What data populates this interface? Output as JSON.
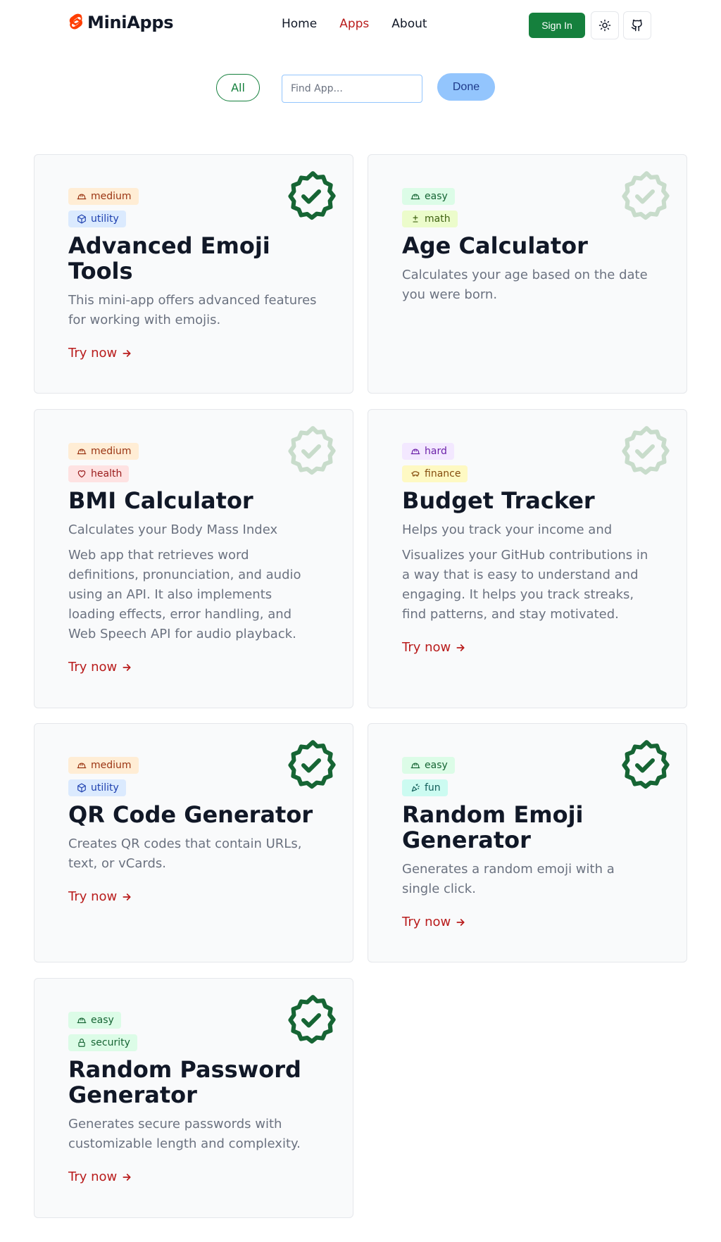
{
  "header": {
    "logo_text": "MiniApps",
    "nav": [
      {
        "label": "Home",
        "active": false
      },
      {
        "label": "Apps",
        "active": true
      },
      {
        "label": "About",
        "active": false
      }
    ],
    "sign_in_label": "Sign In",
    "theme_icon": "sun-icon",
    "github_icon": "github-icon"
  },
  "filters": {
    "all_label": "All",
    "search_placeholder": "Find App...",
    "search_value": "",
    "done_label": "Done"
  },
  "colors": {
    "brand": "#15803d",
    "accent_link": "#b91c1c",
    "seal_done": "#166534",
    "seal_pending": "#c8dccb"
  },
  "cards": [
    {
      "difficulty": "medium",
      "category": "utility",
      "title": "Advanced Emoji Tools",
      "description": "This mini-app offers advanced features for working with emojis.",
      "description_extra": "",
      "link": "Try now",
      "done": true
    },
    {
      "difficulty": "easy",
      "category": "math",
      "title": "Age Calculator",
      "description": "Calculates your age based on the date you were born.",
      "description_extra": "",
      "link": "",
      "done": false
    },
    {
      "difficulty": "medium",
      "category": "health",
      "title": "BMI Calculator",
      "description": "Calculates your Body Mass Index",
      "description_extra": "Web app that retrieves word definitions, pronunciation, and audio using an API. It also implements loading effects, error handling, and Web Speech API for audio playback.",
      "link": "Try now",
      "done": false
    },
    {
      "difficulty": "hard",
      "category": "finance",
      "title": "Budget Tracker",
      "description": "Helps you track your income and",
      "description_extra": "Visualizes your GitHub contributions in a way that is easy to understand and engaging. It helps you track streaks, find patterns, and stay motivated.",
      "link": "Try now",
      "done": false
    },
    {
      "difficulty": "medium",
      "category": "utility",
      "title": "QR Code Generator",
      "description": "Creates QR codes that contain URLs, text, or vCards.",
      "description_extra": "",
      "link": "Try now",
      "done": true
    },
    {
      "difficulty": "easy",
      "category": "fun",
      "title": "Random Emoji Generator",
      "description": "Generates a random emoji with a single click.",
      "description_extra": "",
      "link": "Try now",
      "done": true
    },
    {
      "difficulty": "easy",
      "category": "security",
      "title": "Random Password Generator",
      "description": "Generates secure passwords with customizable length and complexity.",
      "description_extra": "",
      "link": "Try now",
      "done": true
    }
  ]
}
